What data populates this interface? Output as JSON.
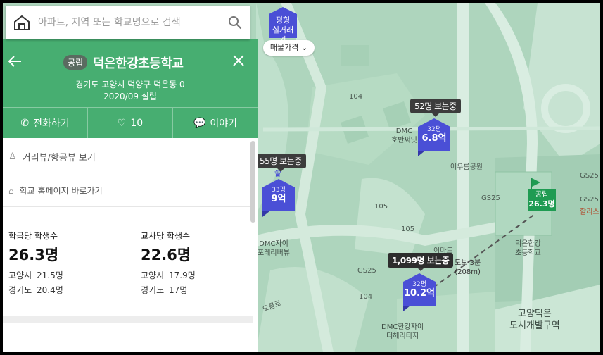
{
  "search": {
    "placeholder": "아파트, 지역 또는 학교명으로 검색"
  },
  "school": {
    "type_tag": "공립",
    "name": "덕은한강초등학교",
    "address": "경기도 고양시 덕양구 덕은동 0",
    "established": "2020/09 설립"
  },
  "actions": {
    "call": "전화하기",
    "likes": "10",
    "talk": "이야기"
  },
  "links": {
    "street_view": "거리뷰/항공뷰 보기",
    "homepage": "학교 홈페이지 바로가기"
  },
  "stats": {
    "per_class": {
      "title": "학급당 학생수",
      "value": "26.3명",
      "rows": [
        {
          "region": "고양시",
          "value": "21.5명"
        },
        {
          "region": "경기도",
          "value": "20.4명"
        }
      ]
    },
    "per_teacher": {
      "title": "교사당 학생수",
      "value": "22.6명",
      "rows": [
        {
          "region": "고양시",
          "value": "17.9명"
        },
        {
          "region": "경기도",
          "value": "17명"
        }
      ]
    }
  },
  "map": {
    "filter_pin": {
      "line1": "평형",
      "line2": "실거래가"
    },
    "price_filter": "매물가격",
    "viewer_badges": [
      "52명 보는중",
      "55명 보는중",
      "1,099명 보는중"
    ],
    "listings": [
      {
        "size": "32평",
        "price": "6.8억"
      },
      {
        "size": "33평",
        "price": "9억"
      },
      {
        "size": "32평",
        "price": "10.2억"
      }
    ],
    "school_marker": {
      "type": "공립",
      "value": "26.3명"
    },
    "distance": {
      "line1": "도보 3분",
      "line2": "(208m)"
    },
    "labels": {
      "b104_top": "104",
      "b105_left": "105",
      "b105_right": "105",
      "b104_bottom": "104",
      "dmc_top_1": "DMC",
      "dmc_top_2": "호반써밋",
      "park": "어우름공원",
      "gs25_a": "GS25",
      "gs25_b": "GS25",
      "gs25_c": "GS25",
      "gs25_d": "GS25",
      "dmc_left_1": "DMC자이",
      "dmc_left_2": "포레리버뷰",
      "emart": "이마트",
      "school_map_1": "덕은한강",
      "school_map_2": "초등학교",
      "halis": "할리스",
      "dmc_bottom_1": "DMC한강자이",
      "dmc_bottom_2": "더헤리티지",
      "district_1": "고양덕은",
      "district_2": "도시개발구역",
      "road": "오름로"
    }
  },
  "colors": {
    "panel_green": "#47ae71",
    "price_blue": "#4a4fd6",
    "school_green": "#1f9b52"
  }
}
